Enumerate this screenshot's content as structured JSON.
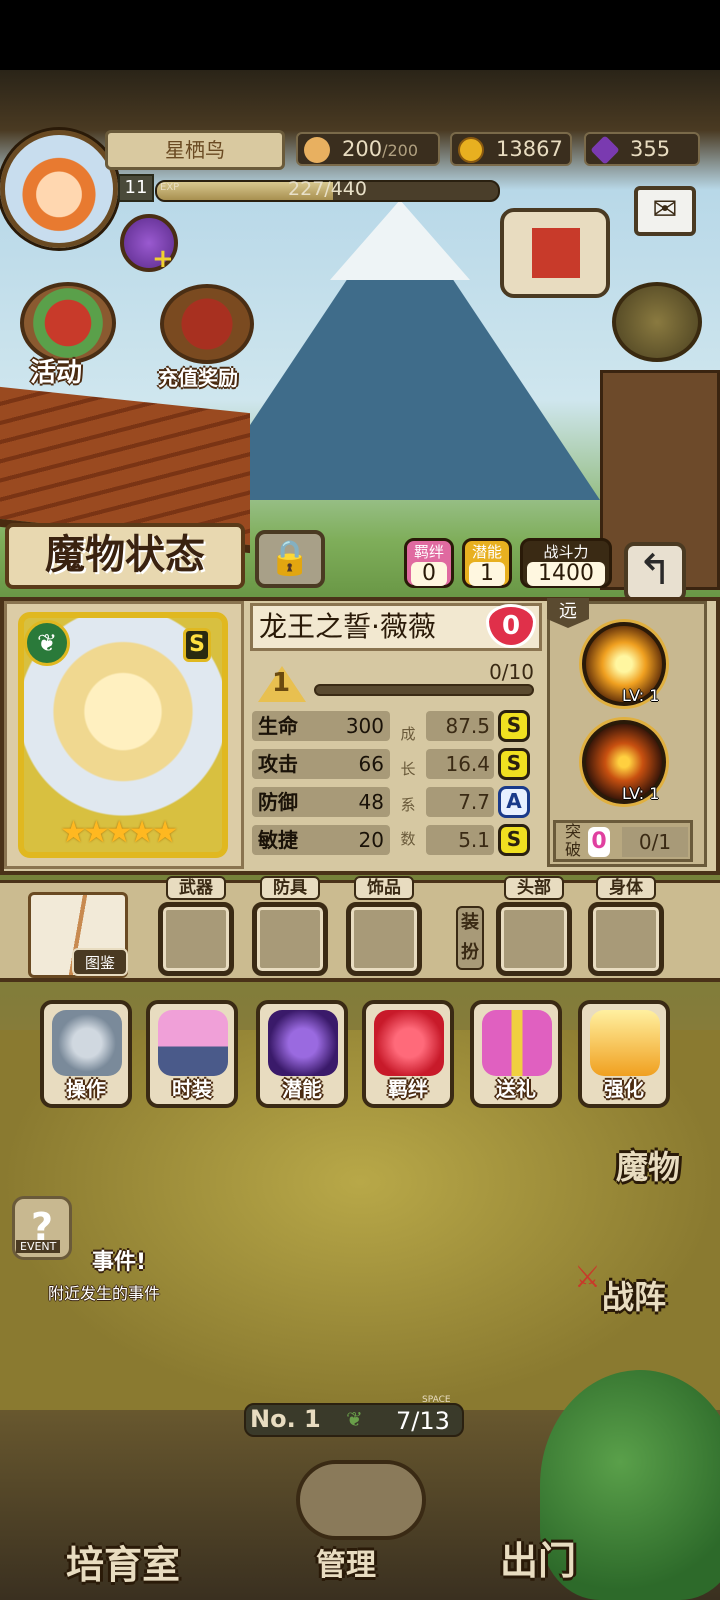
{
  "player": {
    "name": "星栖鸟",
    "level": "11",
    "exp_label": "EXP",
    "exp_text": "227/440",
    "exp_progress": 0.516
  },
  "resources": {
    "stamina_current": "200",
    "stamina_max": "/200",
    "gold": "13867",
    "gems": "355"
  },
  "top_buttons": {
    "event": "活动",
    "recharge_reward": "充值奖励"
  },
  "monster_panel": {
    "title": "魔物状态",
    "bond_label": "羁绊",
    "bond_value": "0",
    "potential_label": "潜能",
    "potential_value": "1",
    "power_label": "战斗力",
    "power_value": "1400",
    "name": "龙王之誓·薇薇",
    "heart_value": "0",
    "rank": "S",
    "level": "1",
    "level_progress_text": "0/10",
    "level_progress": 0.0,
    "stars": 5,
    "stars_text": "★★★★★",
    "stats": [
      {
        "label": "生命",
        "value": "300",
        "growth": "87.5",
        "grade": "S"
      },
      {
        "label": "攻击",
        "value": "66",
        "growth": "16.4",
        "grade": "S"
      },
      {
        "label": "防御",
        "value": "48",
        "growth": "7.7",
        "grade": "A"
      },
      {
        "label": "敏捷",
        "value": "20",
        "growth": "5.1",
        "grade": "S"
      }
    ],
    "growth_chars": [
      "成",
      "长",
      "系",
      "数"
    ],
    "range_label": "远",
    "skills": [
      {
        "lv": "LV: 1"
      },
      {
        "lv": "LV: 1"
      }
    ],
    "breakthrough_label": "突破",
    "breakthrough_value": "0",
    "breakthrough_progress": "0/1"
  },
  "equipment": {
    "codex_label": "图鉴",
    "weapon": "武器",
    "armor": "防具",
    "accessory": "饰品",
    "dress_label": "装扮",
    "head": "头部",
    "body": "身体"
  },
  "actions": [
    "操作",
    "时装",
    "潜能",
    "羁绊",
    "送礼",
    "强化"
  ],
  "event": {
    "tag": "EVENT",
    "title": "事件!",
    "subtitle": "附近发生的事件"
  },
  "side": {
    "monster": "魔物",
    "formation": "战阵"
  },
  "counter": {
    "no_label": "No. 1",
    "space_label": "SPACE",
    "value": "7/13"
  },
  "bottom_nav": {
    "nursery": "培育室",
    "manage": "管理",
    "go_out": "出门"
  },
  "colors": {
    "gold": "#e0b820",
    "grade_s": "#f0e020",
    "panel": "#d6c8a2",
    "heart": "#e0304a"
  }
}
